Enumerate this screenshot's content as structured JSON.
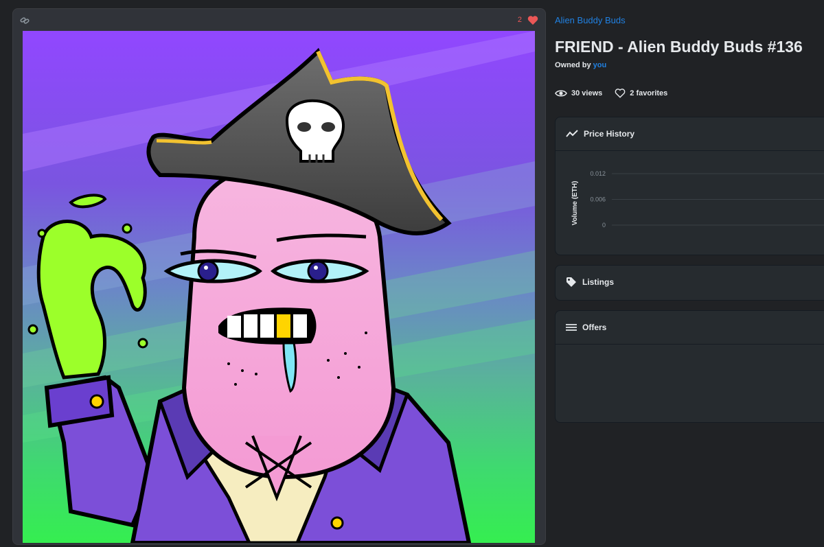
{
  "item": {
    "collection": "Alien Buddy Buds",
    "title": "FRIEND - Alien Buddy Buds #136",
    "owned_prefix": "Owned by",
    "owner": "you",
    "favorites_count": "2",
    "views": "30 views",
    "favorites": "2 favorites"
  },
  "panels": {
    "price_history": "Price History",
    "listings": "Listings",
    "offers": "Offers"
  },
  "icons": [
    "link-icon",
    "heart-filled-icon",
    "eye-icon",
    "heart-outline-icon",
    "trend-line-icon",
    "tag-icon",
    "list-icon"
  ],
  "colors": {
    "accent": "#2081e2",
    "heart": "#eb5757",
    "background": "#202225",
    "panel": "#262b2f"
  },
  "chart_data": {
    "type": "line",
    "title": "",
    "xlabel": "",
    "ylabel": "Volume (ETH)",
    "ylim": [
      0,
      0.012
    ],
    "yticks": [
      "0.012",
      "0.006",
      "0"
    ],
    "series": [],
    "grid": true
  }
}
